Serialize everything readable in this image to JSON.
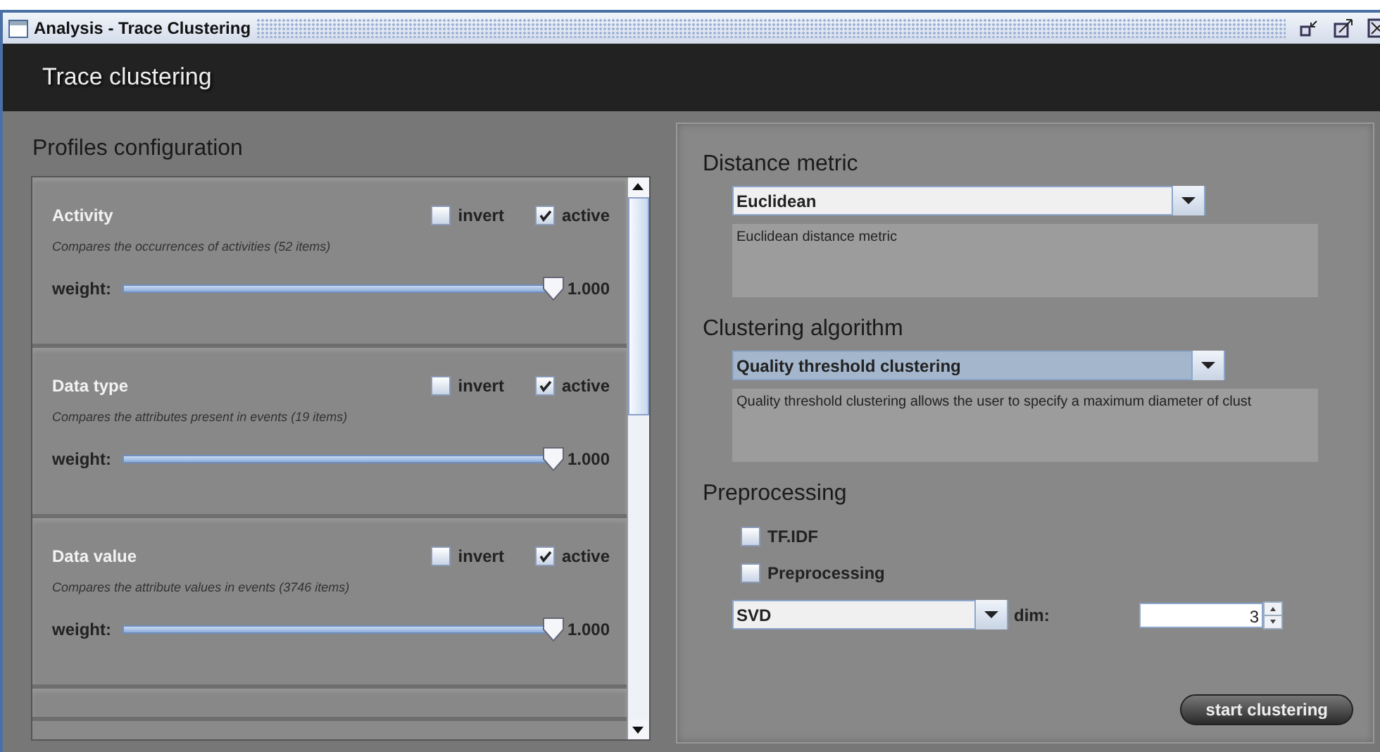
{
  "window": {
    "title": "Analysis - Trace Clustering"
  },
  "header": {
    "title": "Trace clustering"
  },
  "profiles": {
    "title": "Profiles configuration",
    "items": [
      {
        "name": "Activity",
        "description": "Compares the occurrences of activities (52 items)",
        "invert_label": "invert",
        "invert": false,
        "active_label": "active",
        "active": true,
        "weight_label": "weight:",
        "level": 1.0,
        "reading": "1.000"
      },
      {
        "name": "Data type",
        "description": "Compares the attributes present in events (19 items)",
        "invert_label": "invert",
        "invert": false,
        "active_label": "active",
        "active": true,
        "weight_label": "weight:",
        "level": 1.0,
        "reading": "1.000"
      },
      {
        "name": "Data value",
        "description": "Compares the attribute values in events (3746 items)",
        "invert_label": "invert",
        "invert": false,
        "active_label": "active",
        "active": true,
        "weight_label": "weight:",
        "level": 1.0,
        "reading": "1.000"
      }
    ]
  },
  "distance_metric": {
    "title": "Distance metric",
    "value": "Euclidean",
    "description": "Euclidean distance metric"
  },
  "clustering_algorithm": {
    "title": "Clustering algorithm",
    "value": "Quality threshold clustering",
    "description": "Quality threshold clustering allows the user to specify a maximum diameter of clust"
  },
  "preprocessing": {
    "title": "Preprocessing",
    "options": [
      {
        "label": "TF.IDF",
        "checked": false
      },
      {
        "label": "Preprocessing",
        "checked": false
      }
    ],
    "method": "SVD",
    "dim_label": "dim:",
    "dim": "3"
  },
  "start_button": "start clustering"
}
